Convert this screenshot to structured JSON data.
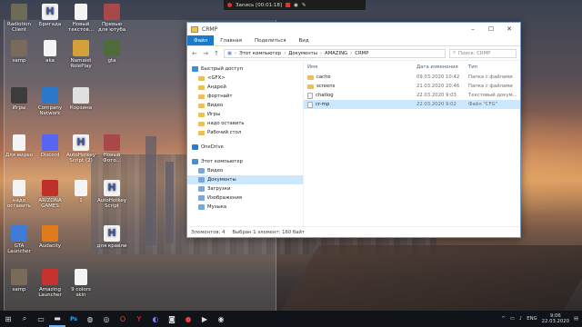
{
  "recorder": {
    "label": "Запись [00:01:18]"
  },
  "desktop_icons": [
    {
      "label": "Radiotion Client",
      "icon": "app-icon",
      "color": "#6d6a56"
    },
    {
      "label": "Бригада",
      "icon": "doc-h-icon"
    },
    {
      "label": "Новый текстов...",
      "icon": "text-file-icon"
    },
    {
      "label": "Превью для ютуба",
      "icon": "image-icon",
      "color": "#a9484a"
    },
    {
      "label": "samp",
      "icon": "samp-icon",
      "color": "#7a6a5a"
    },
    {
      "label": "aka",
      "icon": "text-file-icon"
    },
    {
      "label": "Namaist RolePlay",
      "icon": "app-icon",
      "color": "#d5a03a"
    },
    {
      "label": "gta",
      "icon": "app-icon",
      "color": "#4e6c3a"
    },
    {
      "label": "Игры",
      "icon": "folder-icon",
      "color": "#3c3c3c"
    },
    {
      "label": "Company Network",
      "icon": "network-icon",
      "color": "#2a78c9"
    },
    {
      "label": "Корзина",
      "icon": "recycle-bin-icon",
      "color": "#e0e0e0"
    },
    {
      "label": "Для видео",
      "icon": "text-file-icon"
    },
    {
      "label": "Discord",
      "icon": "discord-icon",
      "color": "#5865f2"
    },
    {
      "label": "AutoHotkey Script (2)",
      "icon": "doc-h-icon"
    },
    {
      "label": "Новый Фото...",
      "icon": "image-icon",
      "color": "#a9484a"
    },
    {
      "label": "надо оставить",
      "icon": "text-file-icon"
    },
    {
      "label": "ARIZONA GAMES",
      "icon": "app-icon",
      "color": "#c0302a"
    },
    {
      "label": "1",
      "icon": "text-file-icon"
    },
    {
      "label": "AutoHotkey Script",
      "icon": "doc-h-icon"
    },
    {
      "label": "GTA Launcher",
      "icon": "app-icon",
      "color": "#3f7ad6"
    },
    {
      "label": "Audacity",
      "icon": "audacity-icon",
      "color": "#e07b1d"
    },
    {
      "label": "для кравли",
      "icon": "doc-h-icon"
    },
    {
      "label": "samp",
      "icon": "samp-icon",
      "color": "#7a6a5a"
    },
    {
      "label": "Amazing Launcher",
      "icon": "app-icon",
      "color": "#c6322d"
    },
    {
      "label": "9 colors skin",
      "icon": "text-file-icon"
    }
  ],
  "explorer": {
    "title": "CRMP",
    "ribbon_tabs": [
      "Файл",
      "Главная",
      "Поделиться",
      "Вид"
    ],
    "path": [
      "Этот компьютер",
      "Документы",
      "AMAZING",
      "CRMP"
    ],
    "search_placeholder": "Поиск: CRMP",
    "nav_items": [
      {
        "label": "Быстрый доступ",
        "top": true,
        "icon": "star-icon",
        "color": "#3c8ee0"
      },
      {
        "label": "<GFX>",
        "icon": "folder-icon"
      },
      {
        "label": "Андрей",
        "icon": "folder-icon"
      },
      {
        "label": "фортнайт",
        "icon": "folder-icon"
      },
      {
        "label": "Видео",
        "icon": "folder-icon"
      },
      {
        "label": "Игры",
        "icon": "folder-icon"
      },
      {
        "label": "надо оставить",
        "icon": "folder-icon"
      },
      {
        "label": "Рабочий стол",
        "icon": "folder-icon"
      },
      {
        "label": "OneDrive",
        "top": true,
        "icon": "cloud-icon",
        "color": "#2a7bd6"
      },
      {
        "label": "Этот компьютер",
        "top": true,
        "icon": "computer-icon",
        "color": "#4a8ed6"
      },
      {
        "label": "Видео",
        "icon": "video-folder-icon"
      },
      {
        "label": "Документы",
        "icon": "documents-icon",
        "selected": true
      },
      {
        "label": "Загрузки",
        "icon": "downloads-icon"
      },
      {
        "label": "Изображения",
        "icon": "pictures-icon"
      },
      {
        "label": "Музыка",
        "icon": "music-icon"
      }
    ],
    "columns": [
      "Имя",
      "Дата изменения",
      "Тип"
    ],
    "files": [
      {
        "name": "cache",
        "date": "09.03.2020 10:42",
        "type": "Папка с файлами",
        "icon": "folder-icon"
      },
      {
        "name": "screens",
        "date": "21.03.2020 20:46",
        "type": "Папка с файлами",
        "icon": "folder-icon"
      },
      {
        "name": "chatlog",
        "date": "22.03.2020 9:03",
        "type": "Текстовый докум...",
        "icon": "text-file-icon"
      },
      {
        "name": "cr-mp",
        "date": "22.03.2020 9:02",
        "type": "Файл \"CFG\"",
        "icon": "cfg-file-icon",
        "selected": true
      }
    ],
    "status": {
      "count": "Элементов: 4",
      "selected": "Выбран 1 элемент: 160 байт"
    }
  },
  "taskbar": {
    "items": [
      "start-icon",
      "search-icon",
      "task-view-icon",
      "file-explorer-icon",
      "photoshop-icon",
      "chrome-icon",
      "steam-icon",
      "opera-icon",
      "yandex-icon",
      "discord-icon",
      "camera-icon",
      "recorder-icon",
      "media-icon",
      "obs-icon"
    ],
    "lang": "ENG",
    "time": "9:06",
    "date": "22.03.2020"
  }
}
